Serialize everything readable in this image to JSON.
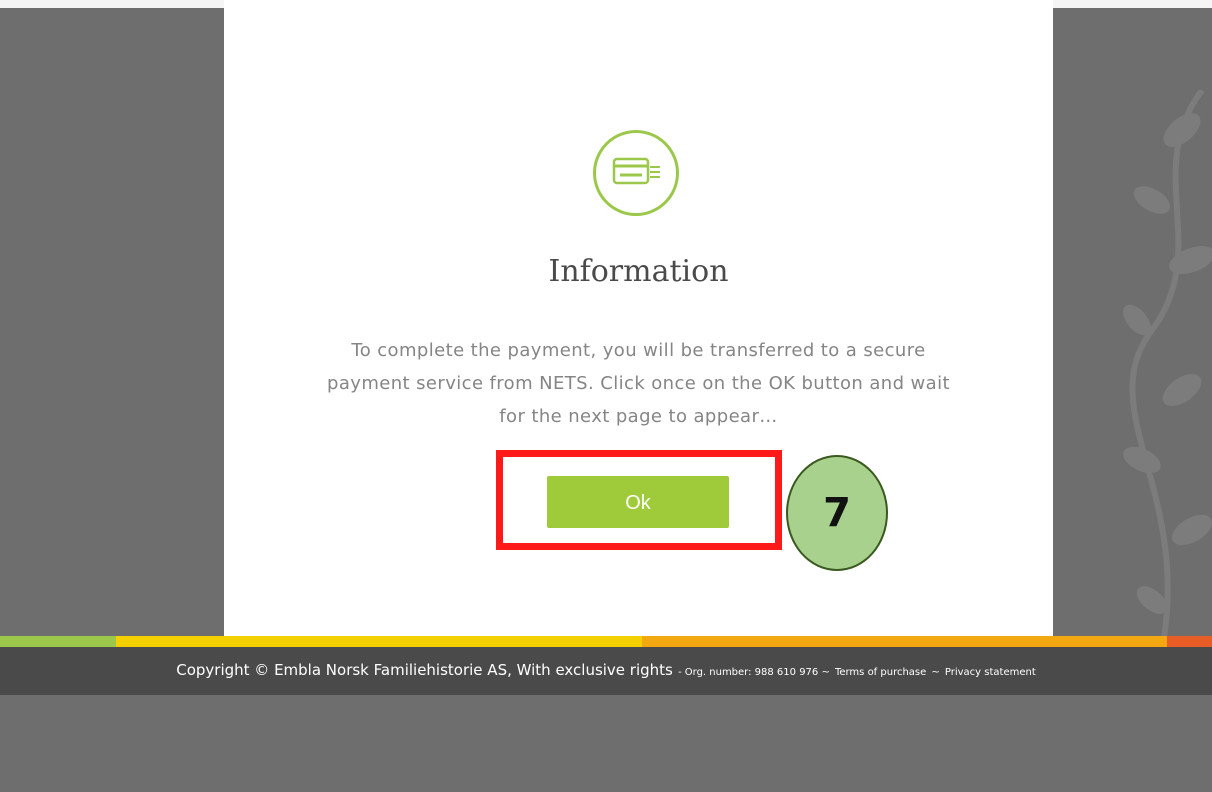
{
  "modal": {
    "icon": "credit-card-icon",
    "title": "Information",
    "message": "To complete the payment, you will be transferred to a secure payment service from NETS. Click once on the OK button and wait for the next page to appear…",
    "ok_label": "Ok"
  },
  "annotation": {
    "step_number": "7",
    "highlight_color": "#ff1a1a",
    "marker_color": "#a8d18d"
  },
  "footer": {
    "copyright": "Copyright © Embla Norsk Familiehistorie AS, With exclusive rights",
    "org_number": "- Org. number: 988 610 976 ~",
    "terms_label": "Terms of purchase",
    "separator": "~",
    "privacy_label": "Privacy statement"
  },
  "colors": {
    "accent_green": "#9fcb3b",
    "color_bar": [
      "#9bc84a",
      "#f5d000",
      "#f3a812",
      "#e85d25"
    ]
  }
}
